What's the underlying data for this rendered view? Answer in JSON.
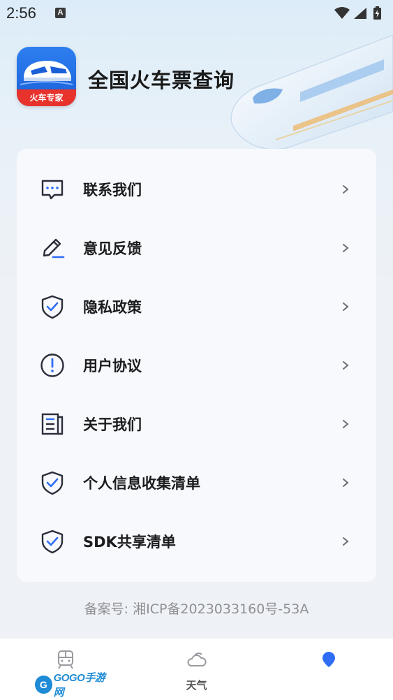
{
  "status_bar": {
    "time": "2:56",
    "notification_letter": "A",
    "icons": [
      "wifi-icon",
      "signal-icon",
      "battery-charging-icon"
    ]
  },
  "header": {
    "app_name": "全国火车票查询",
    "logo_banner_text": "火车专家",
    "hero_image": "bullet-train-illustration"
  },
  "menu": {
    "items": [
      {
        "label": "联系我们",
        "icon": "chat-bubble-icon"
      },
      {
        "label": "意见反馈",
        "icon": "pen-edit-icon"
      },
      {
        "label": "隐私政策",
        "icon": "shield-check-icon"
      },
      {
        "label": "用户协议",
        "icon": "exclamation-circle-icon"
      },
      {
        "label": "关于我们",
        "icon": "document-icon"
      },
      {
        "label": "个人信息收集清单",
        "icon": "shield-check-icon"
      },
      {
        "label": "SDK共享清单",
        "icon": "shield-check-icon"
      }
    ]
  },
  "footer": {
    "icp": "备案号: 湘ICP备2023033160号-53A"
  },
  "tabbar": {
    "tabs": [
      {
        "label": "",
        "icon": "train-icon",
        "active": false
      },
      {
        "label": "天气",
        "icon": "cloud-sun-icon",
        "active": false
      },
      {
        "label": "",
        "icon": "profile-dot-icon",
        "active": true
      }
    ]
  },
  "watermark": {
    "badge": "G",
    "text": "GOGO手游网"
  },
  "colors": {
    "accent": "#2f6df6",
    "icon_stroke": "#2a2d3a",
    "card_bg": "#f7f9fc",
    "page_bg": "#eef1f5",
    "logo_red": "#e8322c",
    "logo_blue": "#1a5fd8"
  }
}
